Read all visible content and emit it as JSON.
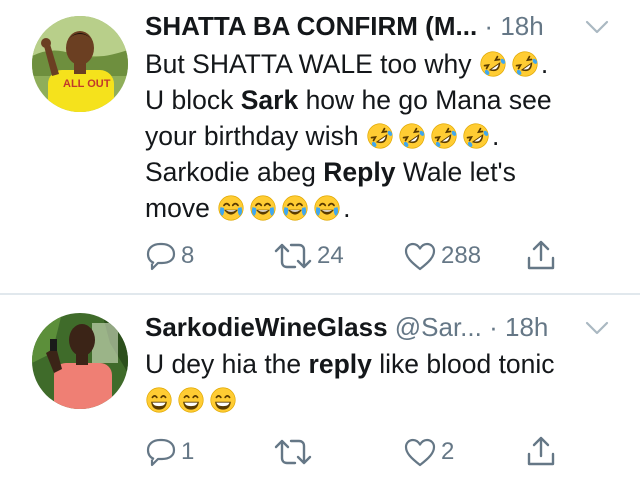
{
  "tweets": [
    {
      "name": "SHATTA BA CONFIRM (M...",
      "handle": "",
      "separator": "·",
      "time": "18h",
      "shirt_text": "ALL OUT",
      "lines": [
        {
          "before": "But SHATTA WALE too why ",
          "bold": "",
          "after": "",
          "emoji": "rofl",
          "emoji_count": 2,
          "tail": "."
        },
        {
          "before": "U block ",
          "bold": "Sark",
          "after": " how he go Mana see",
          "emoji": "",
          "emoji_count": 0,
          "tail": ""
        },
        {
          "before": "your birthday wish ",
          "bold": "",
          "after": "",
          "emoji": "rofl",
          "emoji_count": 4,
          "tail": "."
        },
        {
          "before": "Sarkodie abeg ",
          "bold": "Reply",
          "after": " Wale let's",
          "emoji": "",
          "emoji_count": 0,
          "tail": ""
        },
        {
          "before": "move ",
          "bold": "",
          "after": "",
          "emoji": "joy",
          "emoji_count": 4,
          "tail": "."
        }
      ],
      "counts": {
        "reply": "8",
        "retweet": "24",
        "like": "288"
      }
    },
    {
      "name": "SarkodieWineGlass",
      "handle": "@Sar...",
      "separator": "·",
      "time": "18h",
      "lines": [
        {
          "before": "U dey hia the ",
          "bold": "reply",
          "after": " like blood tonic",
          "emoji": "",
          "emoji_count": 0,
          "tail": ""
        },
        {
          "before": "",
          "bold": "",
          "after": "",
          "emoji": "grin",
          "emoji_count": 3,
          "tail": ""
        }
      ],
      "counts": {
        "reply": "1",
        "retweet": "",
        "like": "2"
      }
    }
  ],
  "icons": {
    "reply": "reply-bubble-icon",
    "retweet": "retweet-icon",
    "like": "heart-icon",
    "share": "share-icon",
    "menu": "chevron-down-icon"
  },
  "colors": {
    "text": "#14171a",
    "muted": "#657786",
    "divider": "#e1e8ed",
    "emoji_face": "#ffcc33"
  }
}
